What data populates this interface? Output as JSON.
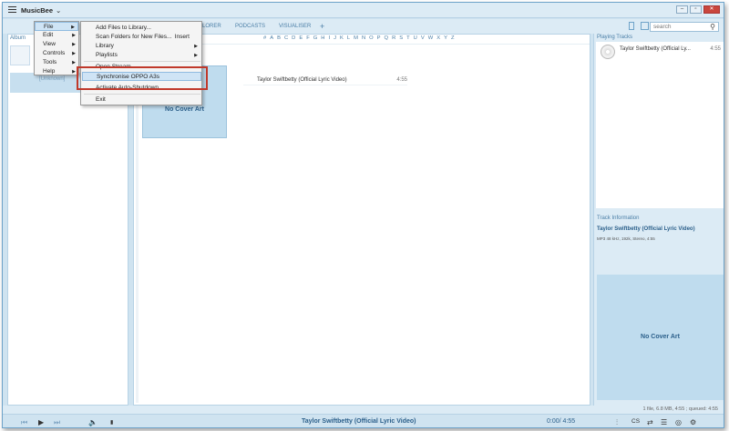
{
  "app": {
    "title": "MusicBee"
  },
  "nav": {
    "tabs": [
      "PLORER",
      "PODCASTS",
      "VISUALISER"
    ],
    "plus": "+",
    "search_placeholder": "search"
  },
  "left_panel": {
    "header": "Album",
    "album_label": "[Unknown]"
  },
  "main": {
    "alphabet": [
      "#",
      "A",
      "B",
      "C",
      "D",
      "E",
      "F",
      "G",
      "H",
      "I",
      "J",
      "K",
      "L",
      "M",
      "N",
      "O",
      "P",
      "Q",
      "R",
      "S",
      "T",
      "U",
      "V",
      "W",
      "X",
      "Y",
      "Z"
    ],
    "cover_text": "No Cover Art",
    "track": {
      "title": "Taylor Swiftbetty (Official Lyric Video)",
      "duration": "4:55"
    }
  },
  "right_panel": {
    "playing_header": "Playing Tracks",
    "playing_title": "Taylor Swiftbetty (Official Ly...",
    "playing_duration": "4:55",
    "info_header": "Track Information",
    "info_title": "Taylor Swiftbetty (Official Lyric Video)",
    "info_meta": "MP3 48 kHz, 192k, Stereo, 4:55",
    "cover_text": "No Cover Art"
  },
  "status": {
    "text": "1 file, 6.8 MB, 4:55 ;   queued: 4:55"
  },
  "player": {
    "title": "Taylor Swiftbetty (Official Lyric Video)",
    "time": "0:00/ 4:55",
    "cs_label": "CS"
  },
  "main_menu": {
    "items": [
      {
        "label": "File",
        "has_submenu": true,
        "highlighted": true
      },
      {
        "label": "Edit",
        "has_submenu": true
      },
      {
        "label": "View",
        "has_submenu": true
      },
      {
        "label": "Controls",
        "has_submenu": true
      },
      {
        "label": "Tools",
        "has_submenu": true
      },
      {
        "label": "Help",
        "has_submenu": true
      }
    ]
  },
  "file_menu": {
    "items": [
      {
        "label": "Add Files to Library..."
      },
      {
        "label": "Scan Folders for New Files...",
        "shortcut": "Insert"
      },
      {
        "label": "Library",
        "has_submenu": true
      },
      {
        "label": "Playlists",
        "has_submenu": true
      },
      {
        "label": "Open Stream..."
      },
      {
        "label": "Synchronise OPPO A3s",
        "highlighted": true
      },
      {
        "label": "Activate Auto-Shutdown..."
      },
      {
        "label": "Exit"
      }
    ]
  },
  "colors": {
    "accent": "#4a7ea6",
    "highlight_box": "#c0392b",
    "cover_bg": "#bfdcee"
  }
}
